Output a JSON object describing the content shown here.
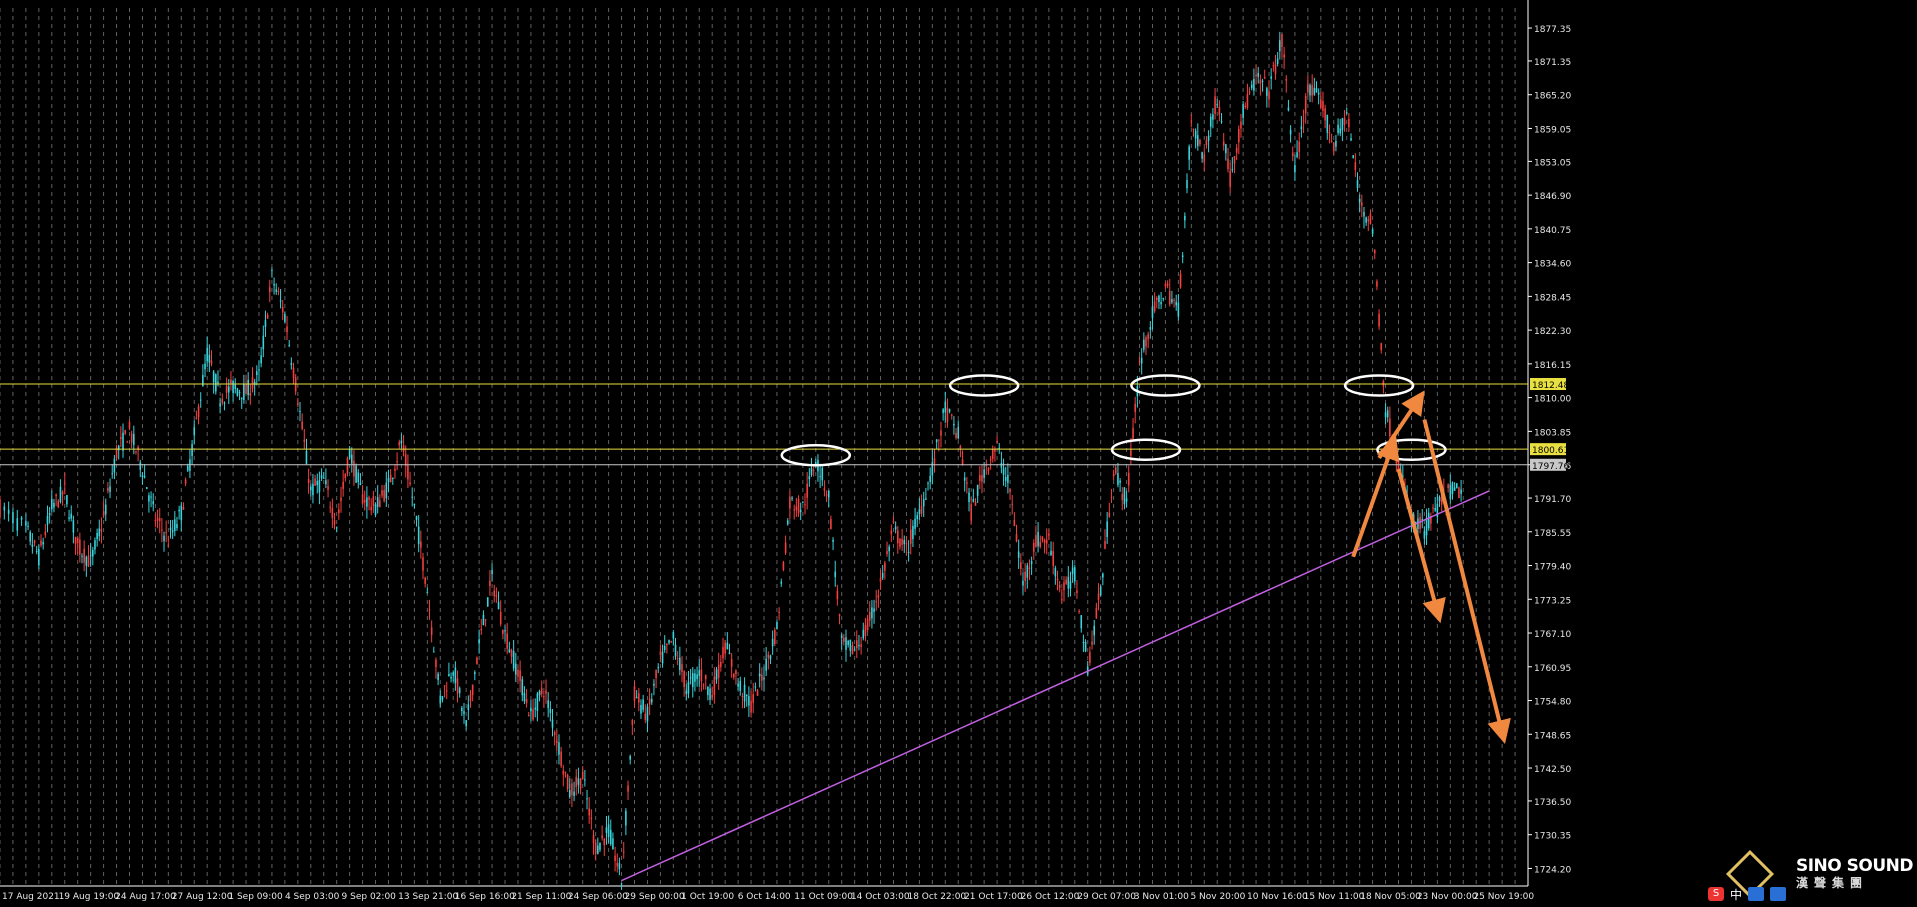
{
  "chart_data": {
    "type": "candlestick",
    "title": "",
    "xlabel": "",
    "ylabel": "",
    "ylim": [
      1721.0,
      1881.0
    ],
    "grid": "vertical dashed",
    "y_ticks": [
      "1877.35",
      "1871.35",
      "1865.20",
      "1859.05",
      "1853.05",
      "1846.90",
      "1840.75",
      "1834.60",
      "1828.45",
      "1822.30",
      "1816.15",
      "1810.00",
      "1803.85",
      "1797.76",
      "1791.70",
      "1785.55",
      "1779.40",
      "1773.25",
      "1767.10",
      "1760.95",
      "1754.80",
      "1748.65",
      "1742.50",
      "1736.50",
      "1730.35",
      "1724.20"
    ],
    "x_ticks": [
      "17 Aug 2021",
      "19 Aug 19:00",
      "24 Aug 17:00",
      "27 Aug 12:00",
      "1 Sep 09:00",
      "4 Sep 03:00",
      "9 Sep 02:00",
      "13 Sep 21:00",
      "16 Sep 16:00",
      "21 Sep 11:00",
      "24 Sep 06:00",
      "29 Sep 00:00",
      "1 Oct 19:00",
      "6 Oct 14:00",
      "11 Oct 09:00",
      "14 Oct 03:00",
      "18 Oct 22:00",
      "21 Oct 17:00",
      "26 Oct 12:00",
      "29 Oct 07:00",
      "3 Nov 01:00",
      "5 Nov 20:00",
      "10 Nov 16:00",
      "15 Nov 11:00",
      "18 Nov 05:00",
      "23 Nov 00:00",
      "25 Nov 19:00"
    ],
    "price_path": [
      [
        0,
        1790
      ],
      [
        2,
        1786
      ],
      [
        3,
        1781
      ],
      [
        4,
        1790
      ],
      [
        5,
        1793
      ],
      [
        6,
        1783
      ],
      [
        7,
        1780
      ],
      [
        8,
        1788
      ],
      [
        9,
        1800
      ],
      [
        10,
        1804
      ],
      [
        11,
        1797
      ],
      [
        12,
        1788
      ],
      [
        13,
        1784
      ],
      [
        14,
        1789
      ],
      [
        15,
        1803
      ],
      [
        16,
        1818
      ],
      [
        17,
        1810
      ],
      [
        18,
        1812
      ],
      [
        19,
        1811
      ],
      [
        20,
        1814
      ],
      [
        21,
        1832
      ],
      [
        22,
        1825
      ],
      [
        23,
        1810
      ],
      [
        24,
        1793
      ],
      [
        25,
        1795
      ],
      [
        26,
        1787
      ],
      [
        27,
        1800
      ],
      [
        28,
        1792
      ],
      [
        29,
        1790
      ],
      [
        30,
        1794
      ],
      [
        31,
        1802
      ],
      [
        32,
        1790
      ],
      [
        33,
        1775
      ],
      [
        34,
        1755
      ],
      [
        35,
        1761
      ],
      [
        36,
        1750
      ],
      [
        37,
        1765
      ],
      [
        38,
        1777
      ],
      [
        39,
        1767
      ],
      [
        40,
        1760
      ],
      [
        41,
        1752
      ],
      [
        42,
        1757
      ],
      [
        43,
        1748
      ],
      [
        44,
        1738
      ],
      [
        45,
        1741
      ],
      [
        46,
        1728
      ],
      [
        47,
        1731
      ],
      [
        48,
        1722
      ],
      [
        49,
        1756
      ],
      [
        50,
        1752
      ],
      [
        51,
        1762
      ],
      [
        52,
        1766
      ],
      [
        53,
        1757
      ],
      [
        54,
        1760
      ],
      [
        55,
        1756
      ],
      [
        56,
        1765
      ],
      [
        57,
        1758
      ],
      [
        58,
        1754
      ],
      [
        59,
        1760
      ],
      [
        60,
        1768
      ],
      [
        61,
        1791
      ],
      [
        62,
        1790
      ],
      [
        63,
        1799
      ],
      [
        64,
        1792
      ],
      [
        65,
        1765
      ],
      [
        66,
        1764
      ],
      [
        67,
        1768
      ],
      [
        68,
        1776
      ],
      [
        69,
        1786
      ],
      [
        70,
        1782
      ],
      [
        71,
        1789
      ],
      [
        72,
        1797
      ],
      [
        73,
        1808
      ],
      [
        74,
        1803
      ],
      [
        75,
        1789
      ],
      [
        76,
        1797
      ],
      [
        77,
        1801
      ],
      [
        78,
        1793
      ],
      [
        79,
        1776
      ],
      [
        80,
        1784
      ],
      [
        81,
        1784
      ],
      [
        82,
        1774
      ],
      [
        83,
        1778
      ],
      [
        84,
        1761
      ],
      [
        85,
        1775
      ],
      [
        86,
        1797
      ],
      [
        87,
        1791
      ],
      [
        88,
        1816
      ],
      [
        89,
        1825
      ],
      [
        90,
        1830
      ],
      [
        91,
        1826
      ],
      [
        92,
        1860
      ],
      [
        93,
        1854
      ],
      [
        94,
        1865
      ],
      [
        95,
        1850
      ],
      [
        96,
        1862
      ],
      [
        97,
        1868
      ],
      [
        98,
        1866
      ],
      [
        99,
        1875
      ],
      [
        100,
        1851
      ],
      [
        101,
        1866
      ],
      [
        102,
        1864
      ],
      [
        103,
        1856
      ],
      [
        104,
        1862
      ],
      [
        105,
        1846
      ],
      [
        106,
        1841
      ],
      [
        107,
        1808
      ],
      [
        108,
        1798
      ],
      [
        109,
        1788
      ],
      [
        110,
        1786
      ],
      [
        111,
        1790
      ],
      [
        112,
        1793
      ],
      [
        113,
        1793
      ]
    ],
    "levels": [
      {
        "value": 1812.48,
        "label": "1812.48",
        "color": "#e8e040"
      },
      {
        "value": 1800.61,
        "label": "1800.61",
        "color": "#e8e040"
      },
      {
        "value": 1797.76,
        "label": "1797.76",
        "color": "#c8c8c8"
      }
    ],
    "trendline": {
      "from": [
        48,
        1722
      ],
      "to": [
        115,
        1793
      ],
      "color": "#c060e0"
    },
    "highlights": [
      {
        "x": 63,
        "y": 1799.5
      },
      {
        "x": 76,
        "y": 1812.2
      },
      {
        "x": 88.5,
        "y": 1800.5
      },
      {
        "x": 90,
        "y": 1812.2
      },
      {
        "x": 106.5,
        "y": 1812.2
      },
      {
        "x": 109,
        "y": 1800.5
      }
    ],
    "arrows": [
      {
        "from": [
          104.5,
          1781
        ],
        "to": [
          107.5,
          1801
        ]
      },
      {
        "from": [
          106.5,
          1799
        ],
        "to": [
          109.5,
          1809.5
        ]
      },
      {
        "from": [
          108,
          1797
        ],
        "to": [
          111,
          1771
        ]
      },
      {
        "from": [
          110,
          1806
        ],
        "to": [
          116,
          1749
        ]
      }
    ],
    "colors": {
      "background": "#000000",
      "grid": "#8a8a8a",
      "bull": "#f44040",
      "bear": "#3ad4dc",
      "axis": "#ffffff",
      "arrow": "#f08840",
      "highlight": "#ffffff"
    }
  },
  "watermark": {
    "brand": "SINO SOUND",
    "sub": "漢聲集團"
  },
  "taskbar": {
    "s": "S",
    "zh": "中"
  }
}
